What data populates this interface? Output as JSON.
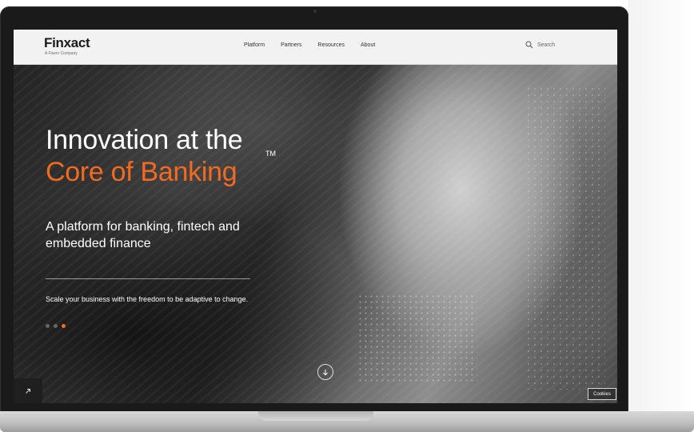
{
  "nav": {
    "logo": "Finxact",
    "logo_sub": "A Fiserv Company",
    "links": [
      "Platform",
      "Partners",
      "Resources",
      "About"
    ],
    "search_label": "Search"
  },
  "hero": {
    "headline_line1": "Innovation at the",
    "headline_line2": "Core of Banking",
    "trademark": "TM",
    "subhead": "A platform for banking, fintech and embedded finance",
    "tagline": "Scale your business with the freedom to be adaptive to change.",
    "carousel_total": 3,
    "carousel_active": 3
  },
  "controls": {
    "scroll_icon": "arrow-down-icon",
    "corner_icon": "arrow-up-right-icon",
    "cookies_label": "Cookies"
  },
  "colors": {
    "accent": "#f26b21",
    "nav_bg": "#f2f2f2"
  }
}
